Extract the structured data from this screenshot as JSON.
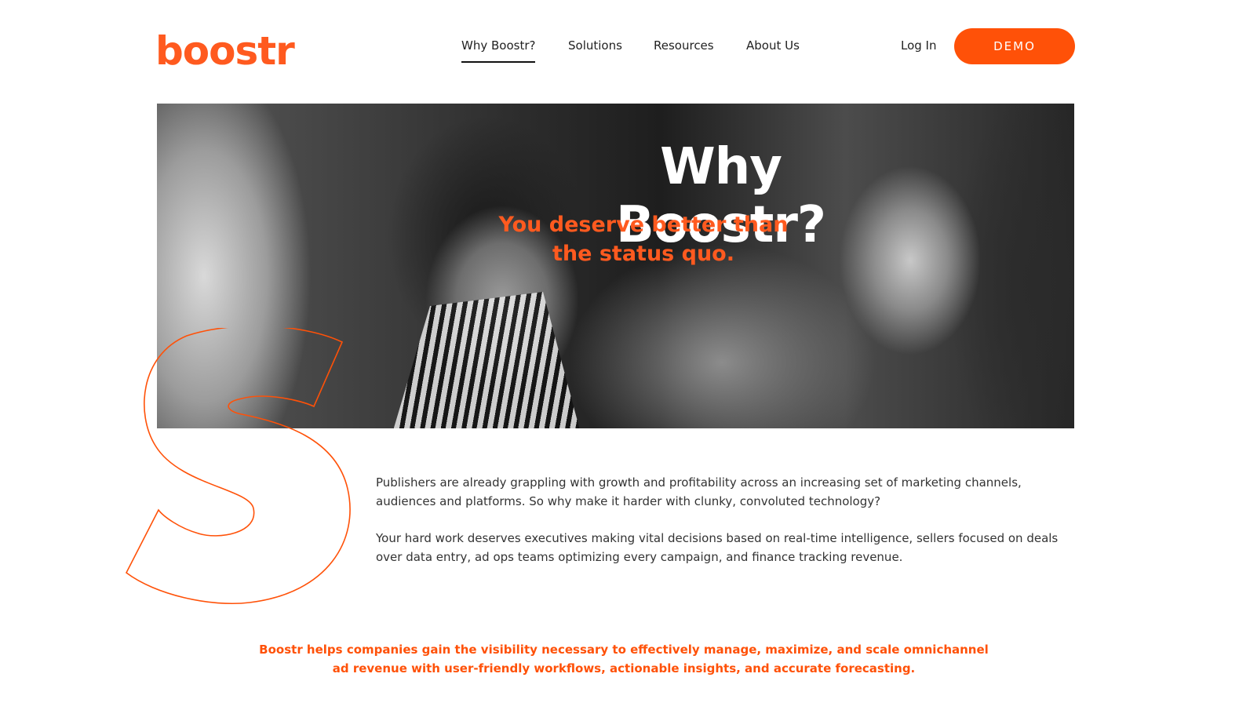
{
  "brand": {
    "logo_text": "boostr",
    "accent_color": "#ff5108"
  },
  "nav": {
    "items": [
      {
        "label": "Why Boostr?",
        "active": true
      },
      {
        "label": "Solutions",
        "active": false
      },
      {
        "label": "Resources",
        "active": false
      },
      {
        "label": "About Us",
        "active": false
      }
    ],
    "login_label": "Log In",
    "demo_label": "DEMO"
  },
  "hero": {
    "title": "Why Boostr?",
    "subtitle_line1": "You deserve better than",
    "subtitle_line2": "the status quo."
  },
  "intro": {
    "paragraph1": "Publishers are already grappling with growth and profitability across an increasing set of marketing channels, audiences and platforms. So why make it harder with clunky, convoluted technology?",
    "paragraph2": "Your hard work deserves executives making vital decisions based on real-time intelligence, sellers focused on deals over data entry, ad ops teams optimizing every campaign, and finance tracking revenue."
  },
  "tagline": {
    "line1": "Boostr helps companies gain the visibility necessary to effectively manage, maximize, and scale omnichannel",
    "line2": "ad revenue with user-friendly workflows, actionable insights, and accurate forecasting."
  }
}
